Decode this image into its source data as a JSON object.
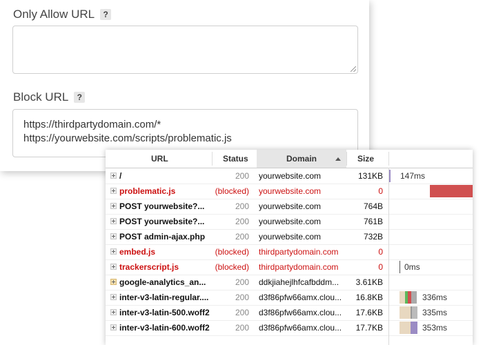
{
  "settings": {
    "only_allow": {
      "label": "Only Allow URL",
      "help": "?",
      "value": ""
    },
    "block": {
      "label": "Block URL",
      "help": "?",
      "value": "https://thirdpartydomain.com/*\nhttps://yourwebsite.com/scripts/problematic.js"
    }
  },
  "network": {
    "columns": {
      "url": "URL",
      "status": "Status",
      "domain": "Domain",
      "size": "Size"
    },
    "sorted_column": "domain",
    "rows": [
      {
        "url": "/",
        "status": "200",
        "domain": "yourwebsite.com",
        "size": "131KB",
        "blocked": false,
        "timing": "147ms"
      },
      {
        "url": "problematic.js",
        "status": "(blocked)",
        "domain": "yourwebsite.com",
        "size": "0",
        "blocked": true,
        "timing": ""
      },
      {
        "url": "POST yourwebsite?...",
        "status": "200",
        "domain": "yourwebsite.com",
        "size": "764B",
        "blocked": false,
        "timing": ""
      },
      {
        "url": "POST yourwebsite?...",
        "status": "200",
        "domain": "yourwebsite.com",
        "size": "761B",
        "blocked": false,
        "timing": ""
      },
      {
        "url": "POST admin-ajax.php",
        "status": "200",
        "domain": "yourwebsite.com",
        "size": "732B",
        "blocked": false,
        "timing": ""
      },
      {
        "url": "embed.js",
        "status": "(blocked)",
        "domain": "thirdpartydomain.com",
        "size": "0",
        "blocked": true,
        "timing": ""
      },
      {
        "url": "trackerscript.js",
        "status": "(blocked)",
        "domain": "thirdpartydomain.com",
        "size": "0",
        "blocked": true,
        "timing": "0ms"
      },
      {
        "url": "google-analytics_an...",
        "status": "200",
        "domain": "ddkjiahejlhfcafbddm...",
        "size": "3.61KB",
        "blocked": false,
        "timing": ""
      },
      {
        "url": "inter-v3-latin-regular....",
        "status": "200",
        "domain": "d3f86pfw66amx.clou...",
        "size": "16.8KB",
        "blocked": false,
        "timing": "336ms"
      },
      {
        "url": "inter-v3-latin-500.woff2",
        "status": "200",
        "domain": "d3f86pfw66amx.clou...",
        "size": "17.6KB",
        "blocked": false,
        "timing": "335ms"
      },
      {
        "url": "inter-v3-latin-600.woff2",
        "status": "200",
        "domain": "d3f86pfw66amx.clou...",
        "size": "17.7KB",
        "blocked": false,
        "timing": "353ms"
      }
    ],
    "colors": {
      "blocked_text": "#cc1111",
      "blocked_bar": "#d05050",
      "wait_bar": "#9b8cc4"
    }
  }
}
